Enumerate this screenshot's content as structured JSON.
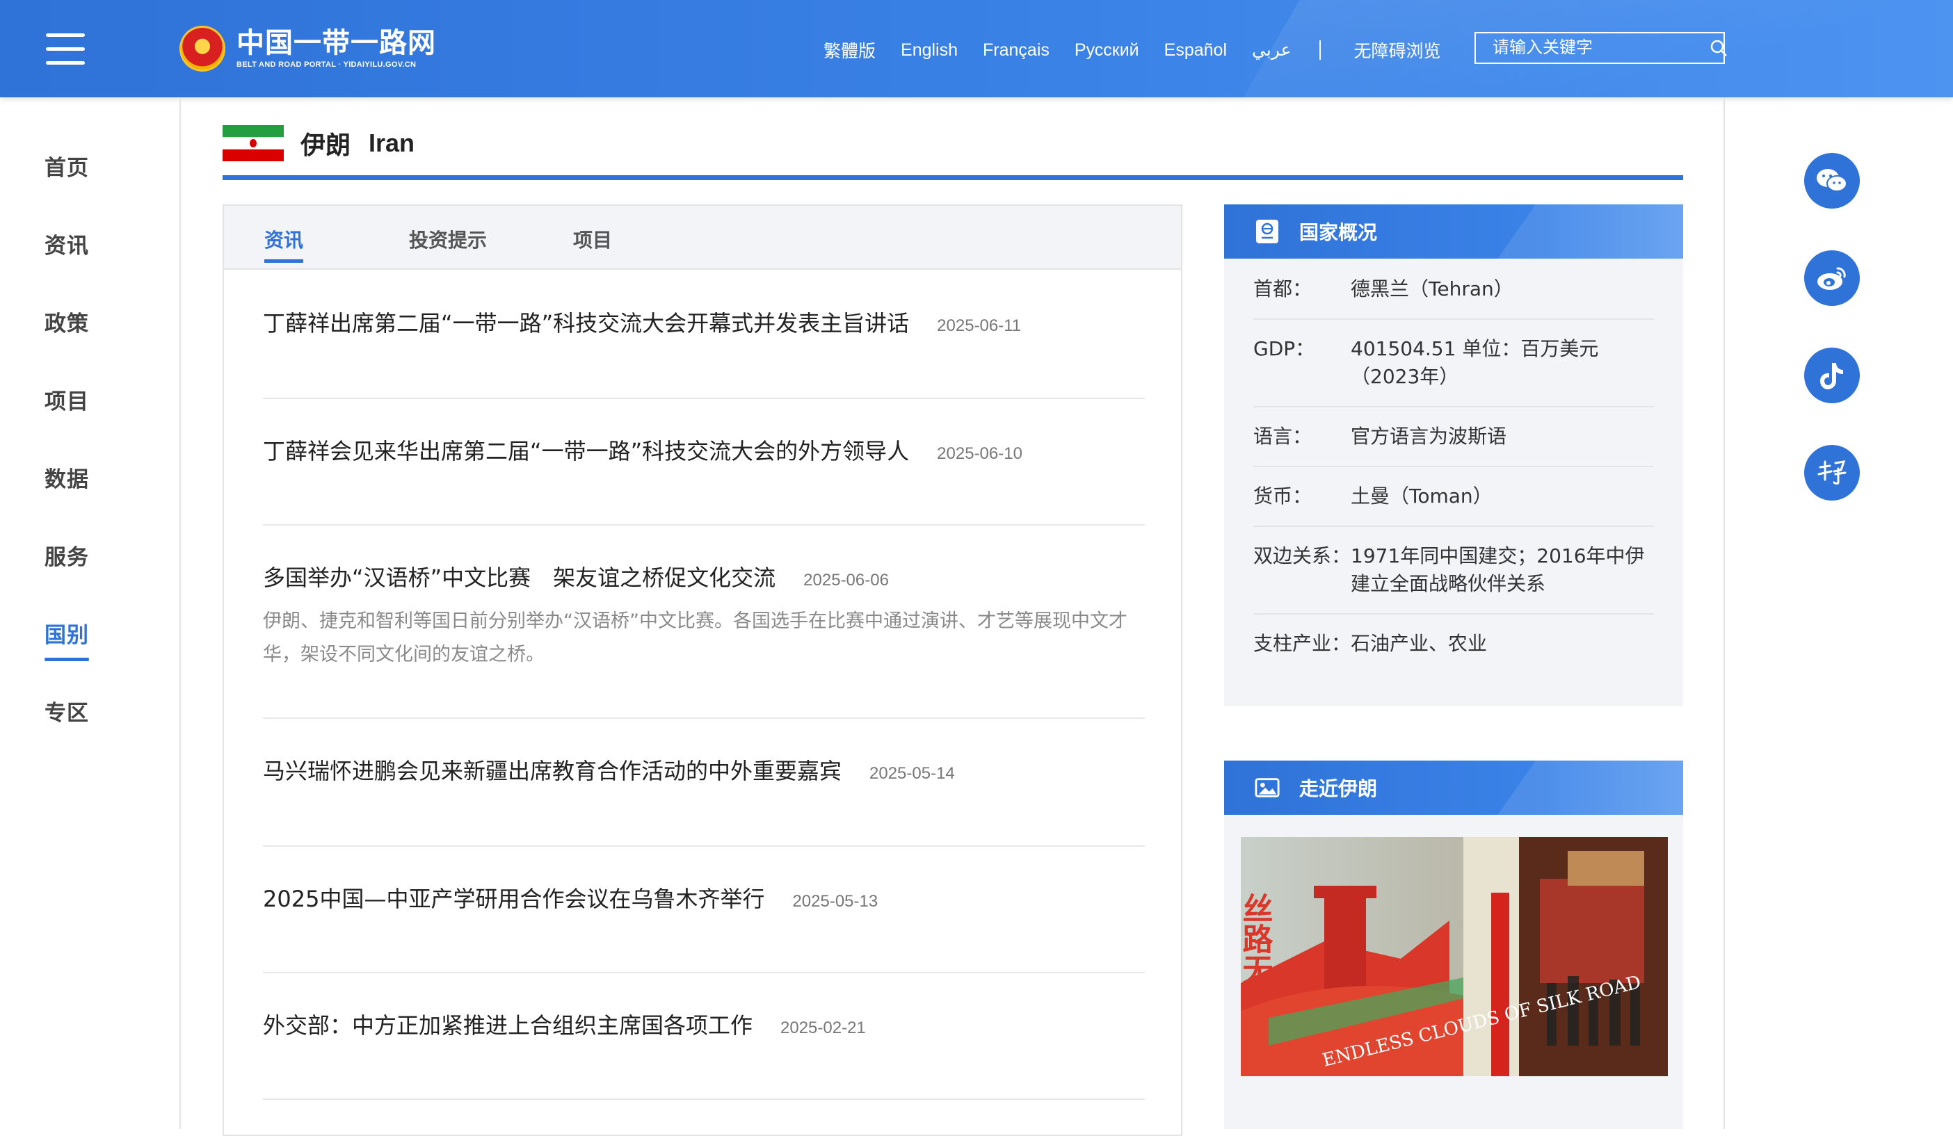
{
  "site": {
    "name_cn": "中国一带一路网",
    "name_en": "BELT AND ROAD PORTAL · YIDAIYILU.GOV.CN"
  },
  "header": {
    "languages": [
      "繁體版",
      "English",
      "Français",
      "Русский",
      "Español",
      "عربي"
    ],
    "accessibility": "无障碍浏览",
    "search_placeholder": "请输入关键字"
  },
  "nav": [
    "首页",
    "资讯",
    "政策",
    "项目",
    "数据",
    "服务",
    "国别",
    "专区"
  ],
  "nav_active": "国别",
  "country": {
    "name_cn": "伊朗",
    "name_en": "Iran"
  },
  "tabs": [
    "资讯",
    "投资提示",
    "项目"
  ],
  "news": [
    {
      "title": "丁薛祥出席第二届“一带一路”科技交流大会开幕式并发表主旨讲话",
      "date": "2025-06-11"
    },
    {
      "title": "丁薛祥会见来华出席第二届“一带一路”科技交流大会的外方领导人",
      "date": "2025-06-10"
    },
    {
      "title": "多国举办“汉语桥”中文比赛　架友谊之桥促文化交流",
      "date": "2025-06-06",
      "summary": "伊朗、捷克和智利等国日前分别举办“汉语桥”中文比赛。各国选手在比赛中通过演讲、才艺等展现中文才华，架设不同文化间的友谊之桥。"
    },
    {
      "title": "马兴瑞怀进鹏会见来新疆出席教育合作活动的中外重要嘉宾",
      "date": "2025-05-14"
    },
    {
      "title": "2025中国—中亚产学研用合作会议在乌鲁木齐举行",
      "date": "2025-05-13"
    },
    {
      "title": "外交部：中方正加紧推进上合组织主席国各项工作",
      "date": "2025-02-21"
    }
  ],
  "overview": {
    "title": "国家概况",
    "facts": [
      {
        "label": "首都：",
        "value": "德黑兰（Tehran）"
      },
      {
        "label": "GDP：",
        "value": "401504.51 单位：百万美元（2023年）"
      },
      {
        "label": "语言：",
        "value": "官方语言为波斯语"
      },
      {
        "label": "货币：",
        "value": "土曼（Toman）"
      },
      {
        "label": "双边关系：",
        "value": "1971年同中国建交；2016年中伊建立全面战略伙伴关系"
      },
      {
        "label": "支柱产业：",
        "value": "石油产业、农业"
      }
    ]
  },
  "gallery": {
    "title": "走近伊朗",
    "photo_caption": "ENDLESS CLOUDS OF SILK ROAD",
    "photo_chars": "丝路无"
  },
  "share": [
    "wechat-icon",
    "weibo-icon",
    "tiktok-icon",
    "xuexi-icon"
  ],
  "colors": {
    "brand": "#2f72d8",
    "header": "#3a82e6",
    "panel": "#f2f4f7"
  }
}
